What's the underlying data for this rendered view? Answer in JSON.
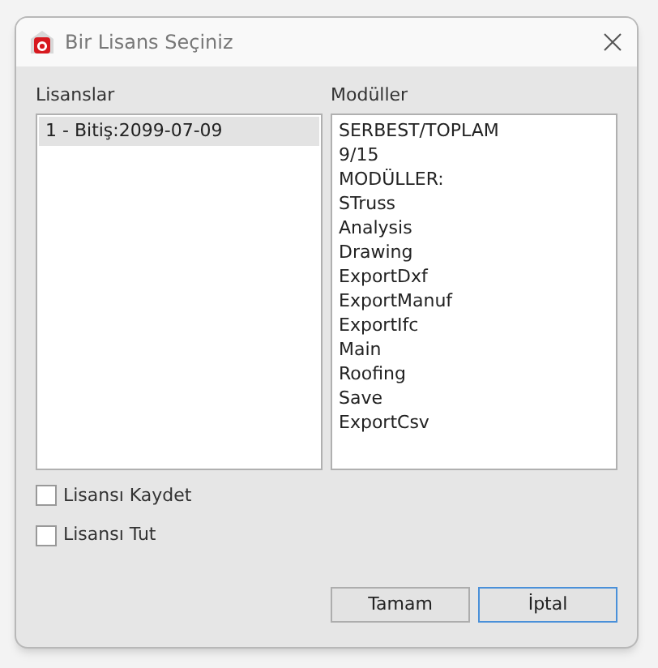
{
  "window": {
    "title": "Bir Lisans Seçiniz"
  },
  "licenses": {
    "label": "Lisanslar",
    "items": [
      {
        "text": "1 - Bitiş:2099-07-09",
        "selected": true
      }
    ]
  },
  "modules": {
    "label": "Modüller",
    "items": [
      "SERBEST/TOPLAM",
      "9/15",
      "MODÜLLER:",
      "STruss",
      "Analysis",
      "Drawing",
      "ExportDxf",
      "ExportManuf",
      "ExportIfc",
      "Main",
      "Roofing",
      "Save",
      "ExportCsv"
    ]
  },
  "checkboxes": [
    {
      "label": "Lisansı Kaydet",
      "checked": false
    },
    {
      "label": "Lisansı Tut",
      "checked": false
    }
  ],
  "buttons": [
    {
      "label": "Tamam",
      "focused": false
    },
    {
      "label": "İptal",
      "focused": true
    }
  ]
}
